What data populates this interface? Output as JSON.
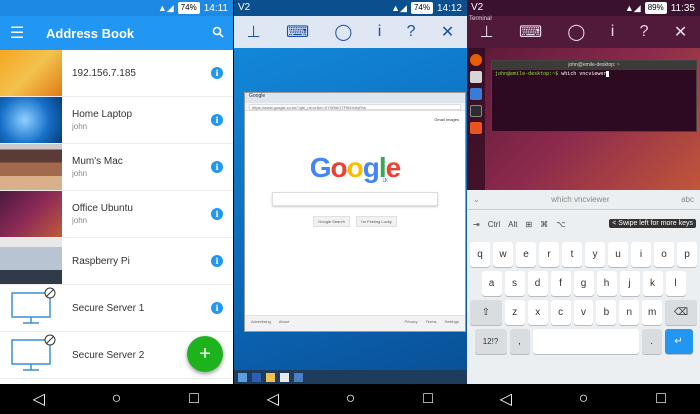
{
  "screen1": {
    "status": {
      "battery": "74%",
      "time": "14:11"
    },
    "appbar": {
      "menu_icon": "menu-icon",
      "title": "Address Book",
      "search_icon": "search-icon"
    },
    "items": [
      {
        "title": "192.156.7.185",
        "subtitle": ""
      },
      {
        "title": "Home Laptop",
        "subtitle": "john"
      },
      {
        "title": "Mum's Mac",
        "subtitle": "john"
      },
      {
        "title": "Office Ubuntu",
        "subtitle": "john"
      },
      {
        "title": "Raspberry Pi",
        "subtitle": ""
      },
      {
        "title": "Secure Server 1",
        "subtitle": ""
      },
      {
        "title": "Secure Server 2",
        "subtitle": ""
      }
    ],
    "info_glyph": "i",
    "fab_label": "+"
  },
  "screen2": {
    "status": {
      "carrier": "V2",
      "battery": "74%",
      "time": "14:12"
    },
    "toolbar": [
      "pin-icon",
      "keyboard-icon",
      "mouse-icon",
      "info-icon",
      "help-icon",
      "close-icon"
    ],
    "toolbar_glyphs": [
      "⊥",
      "⌨",
      "◯",
      "i",
      "?",
      "✕"
    ],
    "browser": {
      "tab": "Google",
      "url": "https://www.google.co.uk/?gfe_rd=cr&ei=XYWhbO7F5t4VxtyfVw",
      "top_links": "Gmail  Images",
      "logo_letters": [
        "G",
        "o",
        "o",
        "g",
        "l",
        "e"
      ],
      "logo_colors": [
        "#4285f4",
        "#ea4335",
        "#fbbc05",
        "#4285f4",
        "#34a853",
        "#ea4335"
      ],
      "logo_sub": "UK",
      "btn_search": "Google Search",
      "btn_lucky": "I'm Feeling Lucky",
      "footer": [
        "Advertising",
        "About",
        "Privacy",
        "Terms",
        "Settings"
      ]
    }
  },
  "screen3": {
    "status": {
      "carrier": "V2",
      "battery": "89%",
      "time": "11:35"
    },
    "window_label": "Terminal",
    "toolbar": [
      "pin-icon",
      "keyboard-icon",
      "mouse-icon",
      "info-icon",
      "help-icon",
      "close-icon"
    ],
    "toolbar_glyphs": [
      "⊥",
      "⌨",
      "◯",
      "i",
      "?",
      "✕"
    ],
    "terminal": {
      "title": "john@emile-desktop: ~",
      "line1": "john@emile-desktop: ~",
      "prompt": "john@emile-desktop:~$",
      "command": " which vncviewer"
    },
    "suggestion": "which vncviewer",
    "suggestion_right": "abc",
    "modkeys": [
      "Ctrl",
      "Alt"
    ],
    "hint": "< Swipe left for more keys",
    "rows": [
      [
        "q",
        "w",
        "e",
        "r",
        "t",
        "y",
        "u",
        "i",
        "o",
        "p"
      ],
      [
        "a",
        "s",
        "d",
        "f",
        "g",
        "h",
        "j",
        "k",
        "l"
      ],
      [
        "z",
        "x",
        "c",
        "v",
        "b",
        "n",
        "m"
      ]
    ],
    "bottom": {
      "sym": "12!?",
      "comma": ",",
      "period": ".",
      "shift": "⇧",
      "delete": "⌫",
      "enter": "↵"
    }
  },
  "nav_glyphs": [
    "◁",
    "○",
    "□"
  ]
}
